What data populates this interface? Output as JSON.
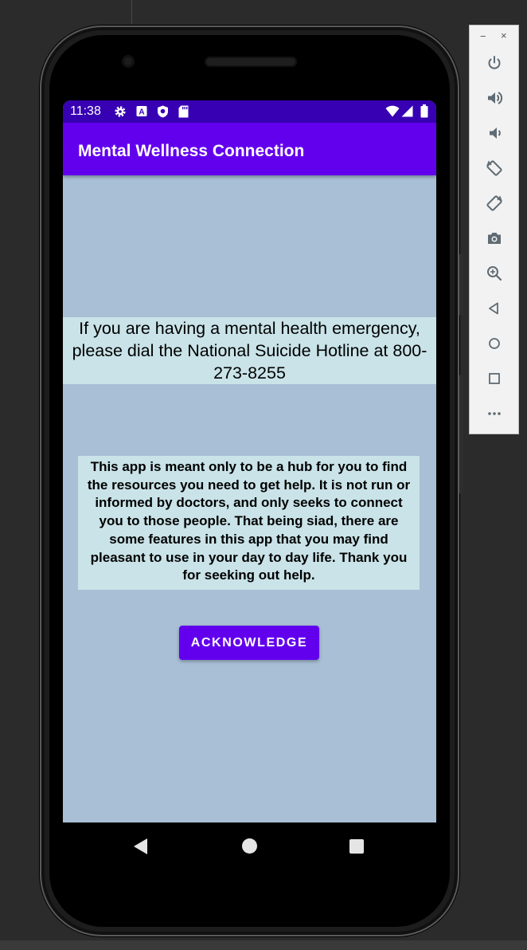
{
  "status_bar": {
    "time": "11:38",
    "icons": [
      "gear-icon",
      "text-a-icon",
      "shield-icon",
      "sd-card-icon",
      "wifi-icon",
      "signal-icon",
      "battery-icon"
    ]
  },
  "app_bar": {
    "title": "Mental Wellness Connection"
  },
  "main": {
    "emergency_text": "If you are having a mental health emergency, please dial the National Suicide Hotline at 800-273-8255",
    "info_text": "This app is meant only to be a hub for you to find the resources you need to get help. It is not run or informed by doctors, and only seeks to connect you to those people. That being siad, there are some features in this app that you may find pleasant to use in your day to day life. Thank you for seeking out help.",
    "acknowledge_label": "ACKNOWLEDGE"
  },
  "nav_bar": {
    "icons": [
      "back-icon",
      "home-icon",
      "recent-apps-icon"
    ]
  },
  "emulator_toolbar": {
    "window_controls": {
      "minimize": "−",
      "close": "×"
    },
    "buttons": [
      "power-icon",
      "volume-up-icon",
      "volume-down-icon",
      "rotate-left-icon",
      "rotate-right-icon",
      "camera-icon",
      "zoom-icon",
      "back-icon",
      "home-icon",
      "overview-icon",
      "more-icon"
    ]
  },
  "colors": {
    "status_bar": "#3700b3",
    "app_bar": "#6200ee",
    "screen_background": "#a9bfd6",
    "text_box_background": "#c9e3e8",
    "button": "#6200ee"
  }
}
